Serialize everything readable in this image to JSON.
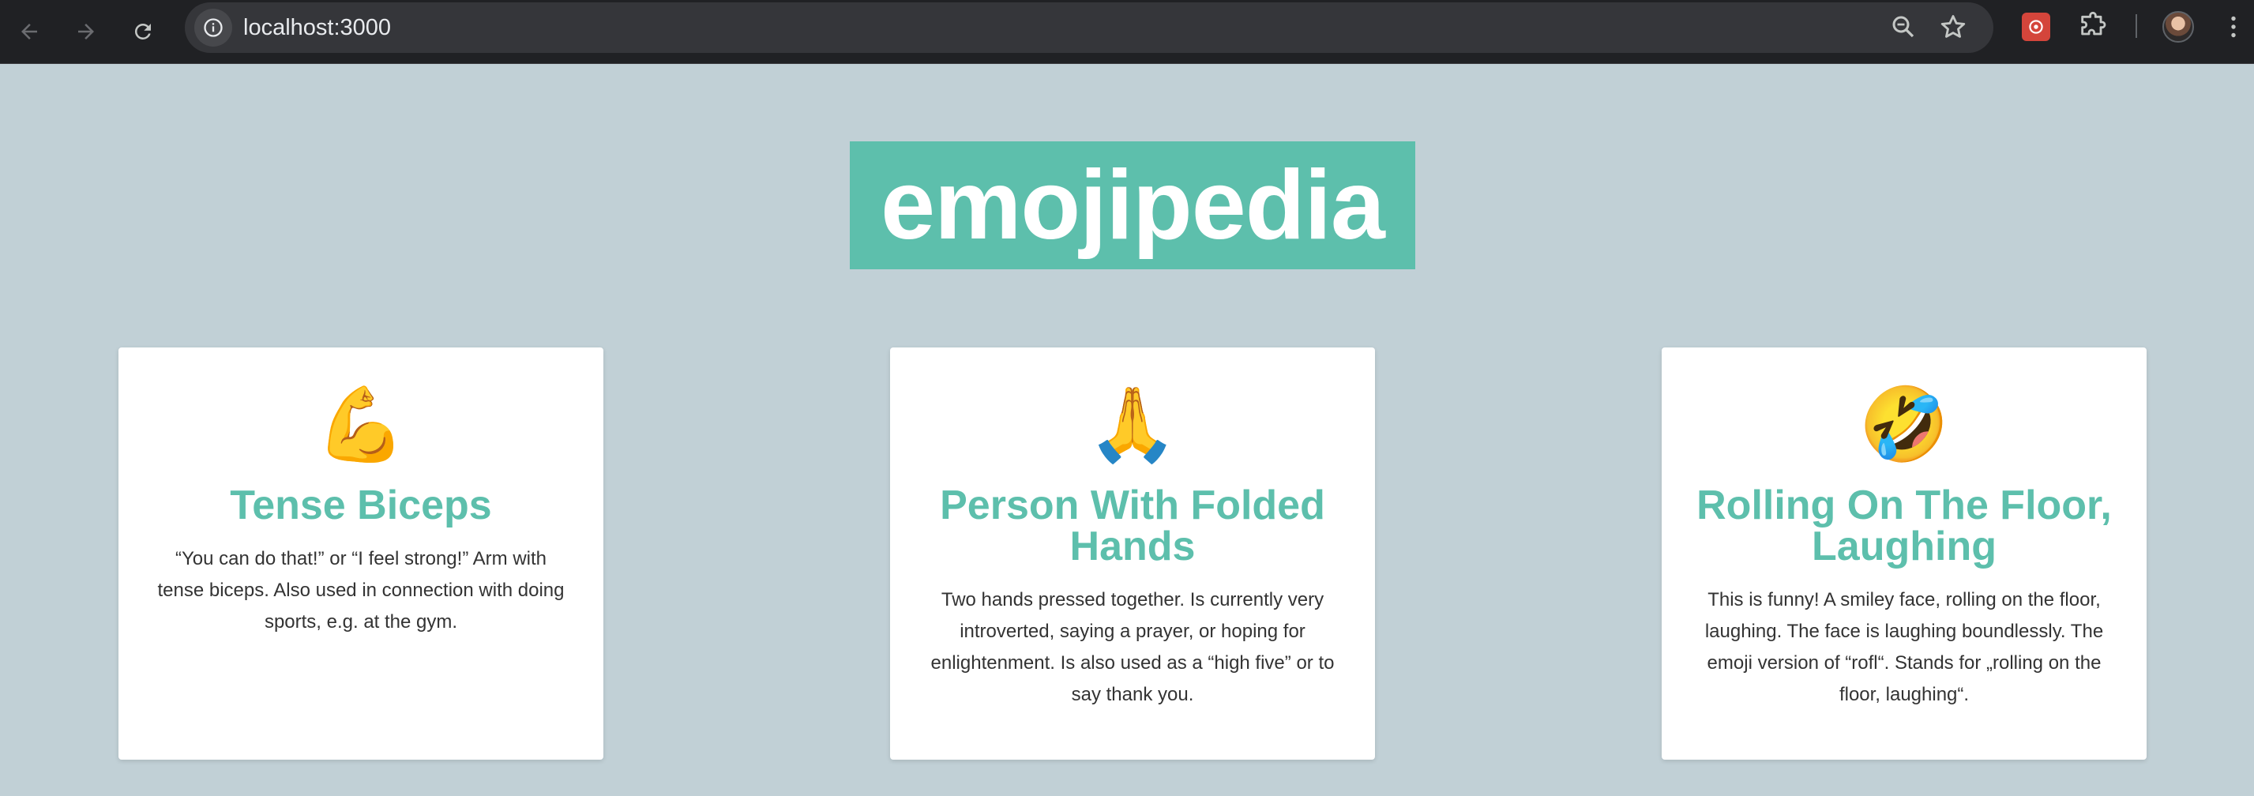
{
  "browser": {
    "url": "localhost:3000",
    "icons": [
      "back-arrow-icon",
      "forward-arrow-icon",
      "reload-icon",
      "info-icon",
      "zoom-icon",
      "star-icon",
      "extension-icon",
      "puzzle-icon",
      "profile-avatar",
      "more-vert-icon"
    ]
  },
  "page": {
    "title": "emojipedia"
  },
  "colors": {
    "background": "#c1d0d6",
    "accent": "#5dbfac",
    "card": "#ffffff",
    "chrome": "#202124"
  },
  "cards": [
    {
      "emoji": "💪",
      "emoji_name": "tense-biceps-emoji",
      "name": "Tense Biceps",
      "meaning": "“You can do that!” or “I feel strong!” Arm with tense biceps. Also used in connection with doing sports, e.g. at the gym."
    },
    {
      "emoji": "🙏",
      "emoji_name": "folded-hands-emoji",
      "name": "Person With Folded Hands",
      "meaning": "Two hands pressed together. Is currently very introverted, saying a prayer, or hoping for enlightenment. Is also used as a “high five” or to say thank you."
    },
    {
      "emoji": "🤣",
      "emoji_name": "rolling-on-floor-laughing-emoji",
      "name": "Rolling On The Floor, Laughing",
      "meaning": "This is funny! A smiley face, rolling on the floor, laughing. The face is laughing boundlessly. The emoji version of “rofl“. Stands for „rolling on the floor, laughing“."
    }
  ]
}
